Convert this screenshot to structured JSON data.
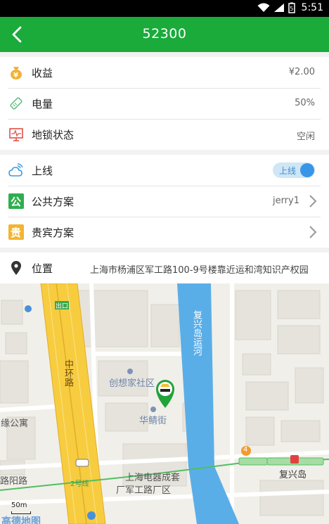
{
  "status_bar": {
    "time": "5:51"
  },
  "app_bar": {
    "title": "52300"
  },
  "info": [
    {
      "label": "收益",
      "value": "¥2.00",
      "icon": "money-bag-icon"
    },
    {
      "label": "电量",
      "value": "50%",
      "icon": "battery-tag-icon"
    },
    {
      "label": "地锁状态",
      "value": "空闲",
      "icon": "monitor-icon"
    }
  ],
  "settings": {
    "online": {
      "label": "上线",
      "toggle_label": "上线",
      "on": true
    },
    "public_plan": {
      "label": "公共方案",
      "value": "jerry1",
      "badge": "公"
    },
    "vip_plan": {
      "label": "贵宾方案",
      "badge": "贵"
    }
  },
  "location": {
    "label": "位置",
    "address": "上海市杨浦区军工路100-9号楼靠近运和湾知识产权园"
  },
  "map": {
    "labels": {
      "road_zhonghuan": "中环路",
      "canal": "复兴岛运河",
      "chuangxiang": "创想家社区",
      "huajing": "华鲭街",
      "yuan_gongyu": "缘公寓",
      "yanglu": "路阳路",
      "dianqi_1": "上海电器成套",
      "dianqi_2": "厂军工路厂区",
      "fuxingdao": "复兴岛",
      "exit": "出口",
      "line2": "2号线",
      "metro_no": "4",
      "scale": "50m",
      "logo": "高德地图"
    },
    "colors": {
      "highway": "#f7cc3f",
      "canal": "#5aaee8",
      "metro": "#4fbf62"
    }
  },
  "colors": {
    "accent": "#1aab3b",
    "toggle": "#3796e8"
  }
}
